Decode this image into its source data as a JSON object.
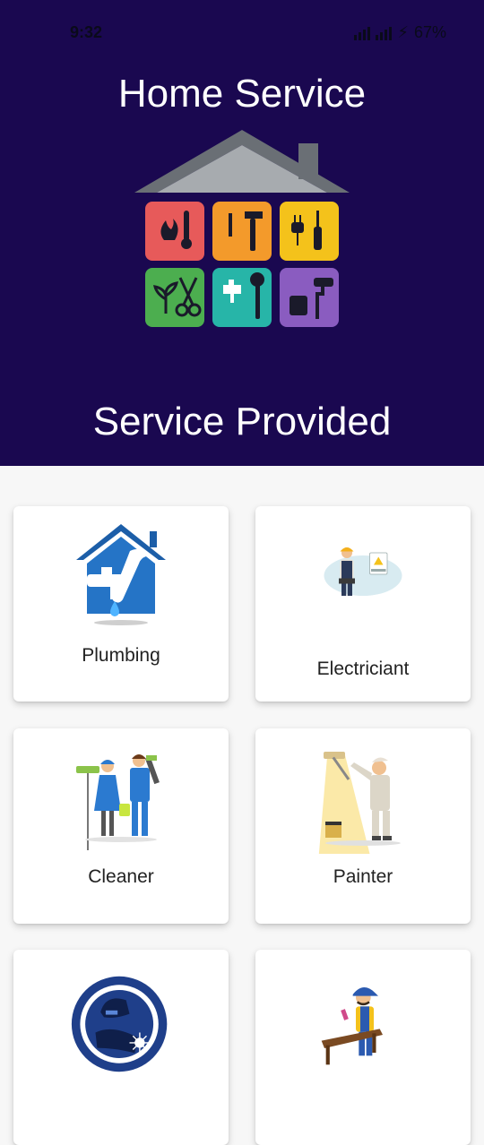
{
  "status_bar": {
    "time": "9:32",
    "battery": "67%",
    "icons": [
      "signal-icon",
      "charging-icon"
    ]
  },
  "header": {
    "title": "Home Service",
    "logo_icon": "house-tools-logo",
    "section_title": "Service Provided"
  },
  "colors": {
    "header_bg": "#1a0850",
    "page_bg": "#f7f7f7",
    "tile_red": "#e75a5a",
    "tile_orange": "#f39a2b",
    "tile_yellow": "#f4c21b",
    "tile_green": "#4cae4f",
    "tile_teal": "#27b5a8",
    "tile_purple": "#8a5cc0"
  },
  "services": [
    {
      "label": "Plumbing",
      "icon": "plumbing-icon"
    },
    {
      "label": "Electriciant",
      "icon": "electrician-icon"
    },
    {
      "label": "Cleaner",
      "icon": "cleaner-icon"
    },
    {
      "label": "Painter",
      "icon": "painter-icon"
    },
    {
      "label": "",
      "icon": "welder-icon"
    },
    {
      "label": "",
      "icon": "carpenter-icon"
    }
  ]
}
